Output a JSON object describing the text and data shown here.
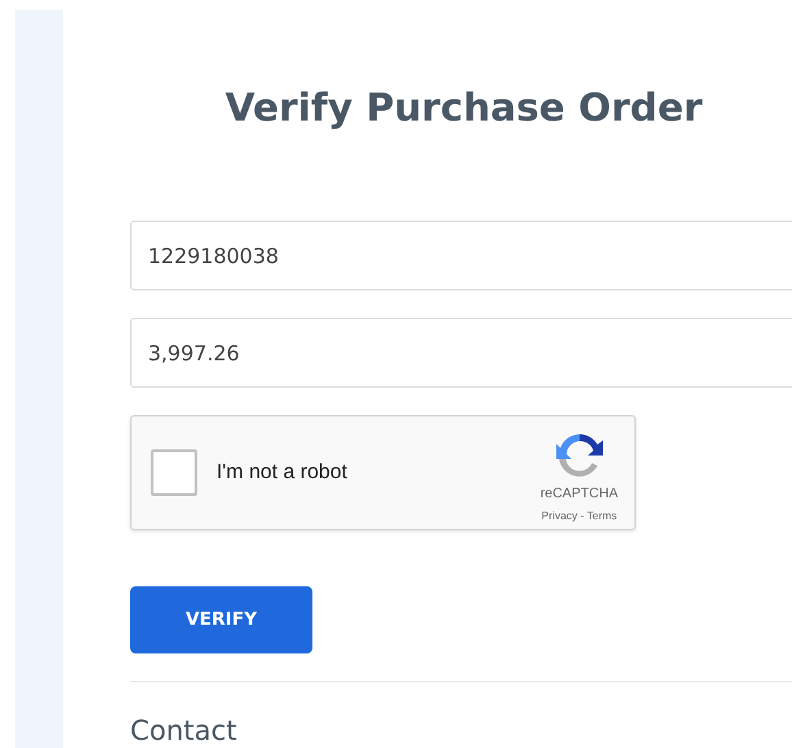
{
  "title": "Verify Purchase Order",
  "fields": [
    {
      "value": "1229180038"
    },
    {
      "value": "3,997.26"
    }
  ],
  "captcha": {
    "label": "I'm not a robot",
    "checked": false,
    "brand": "reCAPTCHA",
    "links": "Privacy - Terms"
  },
  "verify_button": "VERIFY",
  "contact_heading": "Contact"
}
